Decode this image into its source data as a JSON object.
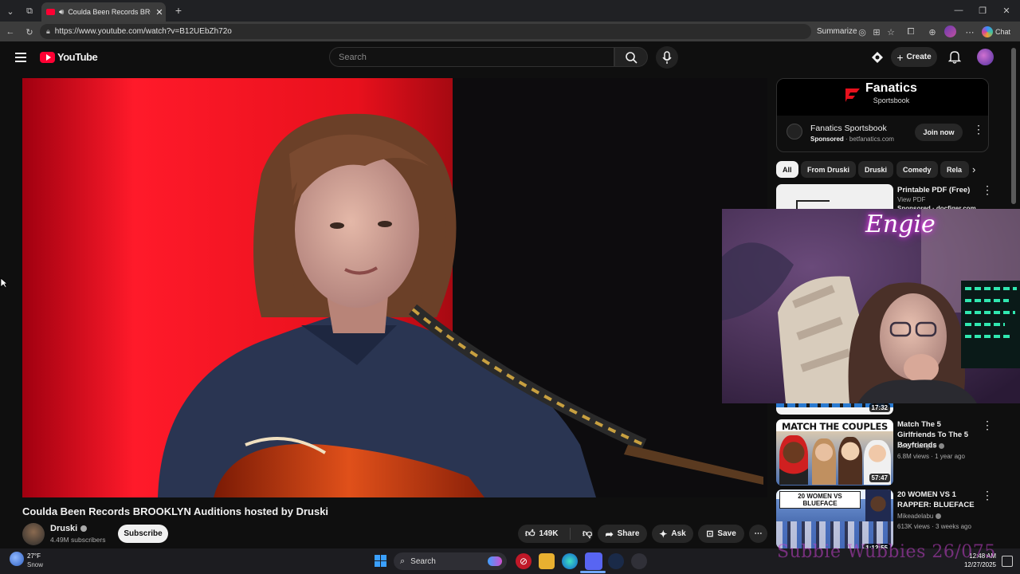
{
  "browser": {
    "tab_title": "Coulda Been Records BROOKL",
    "url": "https://www.youtube.com/watch?v=B12UEbZh72o",
    "summarize_label": "Summarize",
    "chat_label": "Chat"
  },
  "youtube": {
    "logo_text": "YouTube",
    "search_placeholder": "Search",
    "create_label": "Create"
  },
  "video": {
    "title": "Coulda Been Records BROOKLYN Auditions hosted by Druski",
    "channel": "Druski",
    "subscribers": "4.49M subscribers",
    "subscribe_label": "Subscribe",
    "likes": "149K",
    "share_label": "Share",
    "ask_label": "Ask",
    "save_label": "Save"
  },
  "ad": {
    "brand": "Fanatics",
    "brand_sub": "Sportsbook",
    "title": "Fanatics Sportsbook",
    "sponsored": "Sponsored",
    "domain": "· betfanatics.com",
    "cta": "Join now"
  },
  "chips": [
    "All",
    "From Druski",
    "Druski",
    "Comedy",
    "Rela"
  ],
  "sponsored_item": {
    "title": "Printable PDF (Free)",
    "sub": "View PDF",
    "sponsored": "Sponsored · docfiger.com"
  },
  "recommendations": [
    {
      "duration": "17:32"
    },
    {
      "title": "Match The 5 Girlfriends To The 5 Boyfriends",
      "channel": "Kevin Langue",
      "meta": "6.8M views · 1 year ago",
      "duration": "57:47",
      "thumb_text": "MATCH THE COUPLES"
    },
    {
      "title": "20 WOMEN VS 1 RAPPER: BLUEFACE",
      "channel": "Mikeadelabu",
      "meta": "613K views · 3 weeks ago",
      "duration": "1:12:55",
      "thumb_text": "20 WOMEN VS BLUEFACE"
    }
  ],
  "overlay": {
    "neon_text": "Engie",
    "watermark": "Subbie Wubbies 26/075"
  },
  "taskbar": {
    "temp": "27°F",
    "weather": "Snow",
    "search_label": "Search",
    "time": "12:48 AM",
    "date": "12/27/2025"
  },
  "colors": {
    "accent_red": "#ff0033",
    "background": "#0f0f0f"
  }
}
